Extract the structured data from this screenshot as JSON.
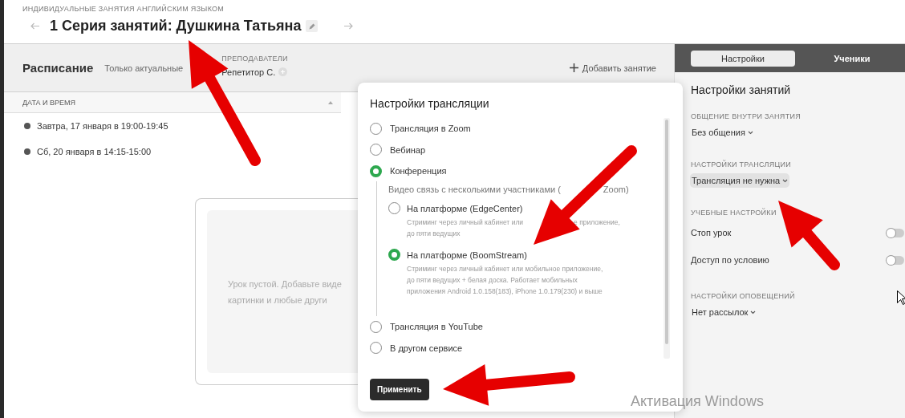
{
  "header": {
    "subtitle": "ИНДИВИДУАЛЬНЫЕ ЗАНЯТИЯ АНГЛИЙСКИМ ЯЗЫКОМ",
    "title": "1 Серия занятий: Душкина Татьяна"
  },
  "schedule": {
    "title": "Расписание",
    "filter": "Только актуальные",
    "teachers_label": "ПРЕПОДАВАТЕЛИ",
    "teacher": "Репетитор С.",
    "add_button": "Добавить занятие"
  },
  "table": {
    "columns": [
      "ДАТА И ВРЕМЯ"
    ],
    "rows": [
      {
        "datetime": "Завтра, 17 января в 19:00-19:45"
      },
      {
        "datetime": "Сб, 20 января в 14:15-15:00"
      }
    ]
  },
  "lesson_card": {
    "empty_text": [
      "Урок пустой. Добавьте виде",
      "картинки и любые други"
    ]
  },
  "settings_panel": {
    "tabs": [
      {
        "label": "Настройки",
        "selected": true
      },
      {
        "label": "Ученики",
        "selected": false
      }
    ],
    "title": "Настройки занятий",
    "sections": [
      {
        "label": "ОБЩЕНИЕ ВНУТРИ ЗАНЯТИЯ",
        "kind": "dropdown",
        "value": "Без общения",
        "highlighted": false
      },
      {
        "label": "НАСТРОЙКИ ТРАНСЛЯЦИИ",
        "kind": "dropdown",
        "value": "Трансляция не нужна",
        "highlighted": true
      },
      {
        "label": "УЧЕБНЫЕ НАСТРОЙКИ",
        "kind": "toggles",
        "toggles": [
          {
            "label": "Стоп урок",
            "on": false
          },
          {
            "label": "Доступ по условию",
            "on": false
          }
        ]
      },
      {
        "label": "НАСТРОЙКИ ОПОВЕЩЕНИЙ",
        "kind": "dropdown",
        "value": "Нет рассылок",
        "highlighted": false
      }
    ]
  },
  "dialog": {
    "title": "Настройки трансляции",
    "options": [
      {
        "label": "Трансляция в Zoom",
        "selected": false
      },
      {
        "label": "Вебинар",
        "selected": false
      },
      {
        "label": "Конференция",
        "selected": true,
        "group": {
          "note": [
            "Видео связь с несколькими участниками (",
            "Zoom)"
          ],
          "options": [
            {
              "label": "На платформе (EdgeCenter)",
              "selected": false,
              "description": [
                [
                  "Стриминг через личный кабинет или",
                  "е приложение,"
                ],
                [
                  "до пяти ведущих"
                ]
              ]
            },
            {
              "label": "На платформе (BoomStream)",
              "selected": true,
              "description": [
                [
                  "Стриминг через личный кабинет или мобильное приложение,"
                ],
                [
                  "до пяти ведущих + белая доска. Работает мобильных"
                ],
                [
                  "приложения Android 1.0.158(183), iPhone 1.0.179(230) и выше"
                ]
              ]
            }
          ]
        }
      },
      {
        "label": "Трансляция в YouTube",
        "selected": false
      },
      {
        "label": "В другом сервисе",
        "selected": false
      }
    ],
    "apply_button": "Применить"
  },
  "os_notice": "Активация Windows"
}
